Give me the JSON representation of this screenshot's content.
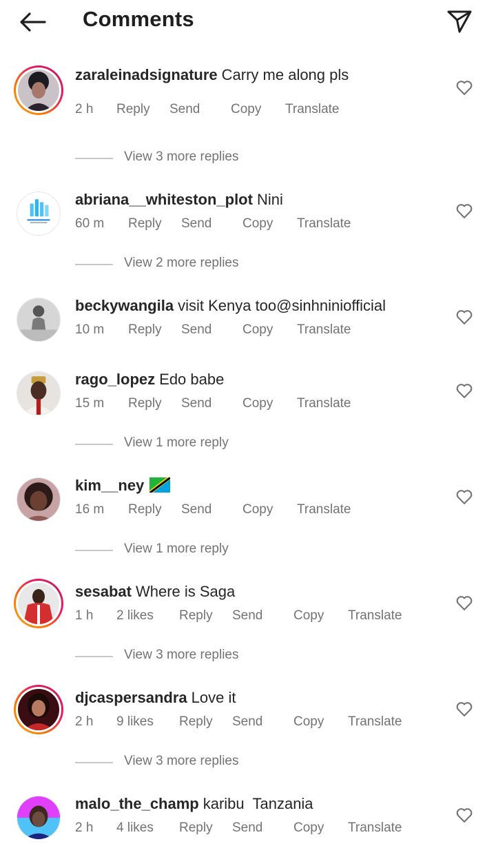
{
  "header": {
    "title": "Comments",
    "back_icon": "arrow-left-icon",
    "share_icon": "paper-plane-icon"
  },
  "colors": {
    "text": "#262626",
    "secondary": "#737373",
    "story_ring_start": "#f9a825",
    "story_ring_end": "#c2185b"
  },
  "actions": {
    "reply": "Reply",
    "send": "Send",
    "copy": "Copy",
    "translate": "Translate"
  },
  "comments": [
    {
      "username": "zaraleinadsignature",
      "text": "Carry me along pls",
      "time": "2 h",
      "likes": "",
      "view_more": "View 3 more replies"
    },
    {
      "username": "abriana__whiteston_plot",
      "text": "Nini",
      "time": "60 m",
      "likes": "",
      "view_more": "View 2 more replies"
    },
    {
      "username": "beckywangila",
      "text": "visit Kenya too@sinhniniofficial",
      "time": "10 m",
      "likes": "",
      "view_more": ""
    },
    {
      "username": "rago_lopez",
      "text": "Edo babe",
      "time": "15 m",
      "likes": "",
      "view_more": "View 1 more reply"
    },
    {
      "username": "kim__ney",
      "text": "",
      "time": "16 m",
      "likes": "",
      "view_more": "View 1 more reply",
      "emoji": "tanzania-flag-icon"
    },
    {
      "username": "sesabat",
      "text": "Where is Saga",
      "time": "1 h",
      "likes": "2 likes",
      "view_more": "View 3 more replies"
    },
    {
      "username": "djcaspersandra",
      "text": "Love it",
      "time": "2 h",
      "likes": "9 likes",
      "view_more": "View 3 more replies"
    },
    {
      "username": "malo_the_champ",
      "text": "karibu  Tanzania",
      "time": "2 h",
      "likes": "4 likes",
      "view_more": ""
    }
  ]
}
